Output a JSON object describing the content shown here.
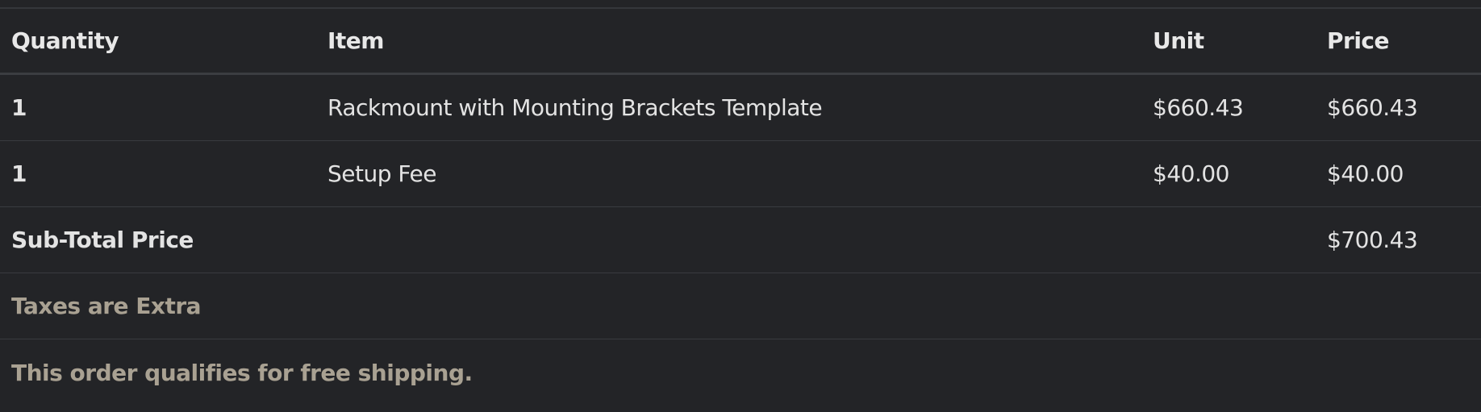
{
  "table": {
    "headers": {
      "quantity": "Quantity",
      "item": "Item",
      "unit": "Unit",
      "price": "Price"
    },
    "rows": [
      {
        "quantity": "1",
        "item": "Rackmount with Mounting Brackets Template",
        "unit": "$660.43",
        "price": "$660.43"
      },
      {
        "quantity": "1",
        "item": "Setup Fee",
        "unit": "$40.00",
        "price": "$40.00"
      }
    ],
    "subtotal": {
      "label": "Sub-Total Price",
      "value": "$700.43"
    },
    "notes": {
      "taxes": "Taxes are Extra",
      "shipping": "This order qualifies for free shipping."
    }
  },
  "colors": {
    "background": "#232427",
    "text": "#e3e3e3",
    "muted_note": "#a9a192",
    "divider": "#393b3f"
  }
}
